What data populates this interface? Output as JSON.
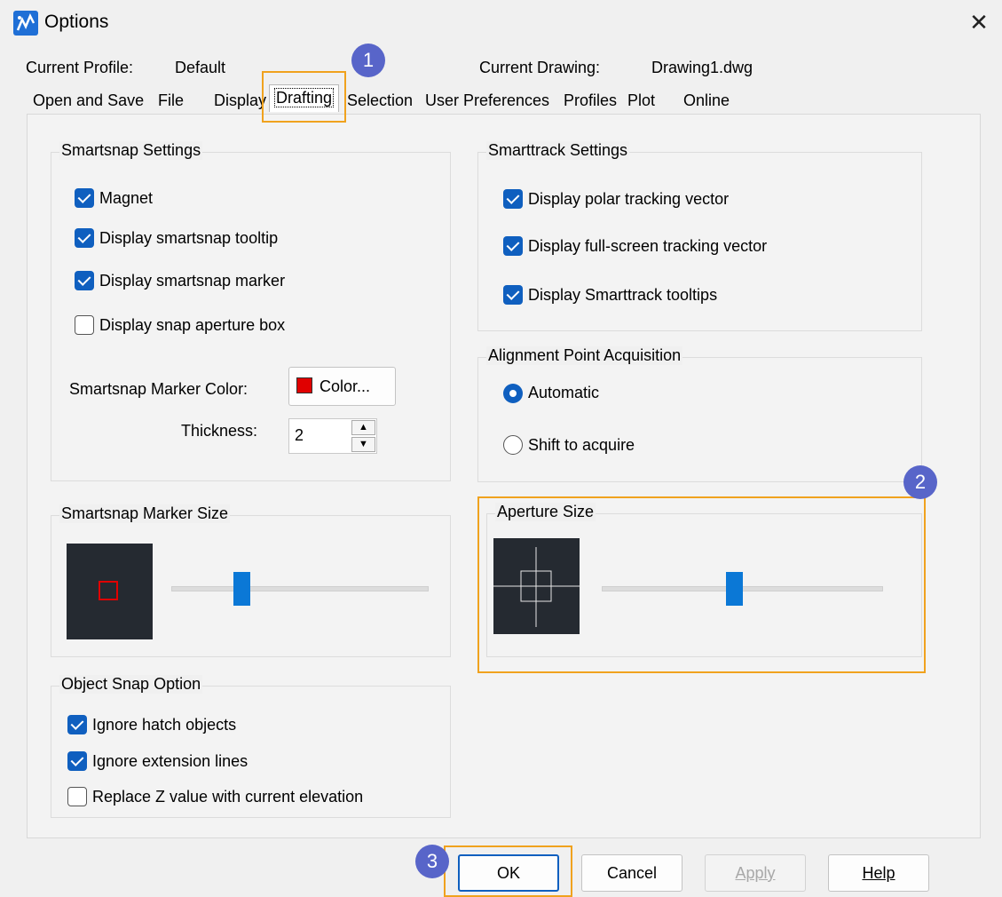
{
  "window": {
    "title": "Options",
    "close_glyph": "✕"
  },
  "profile": {
    "label": "Current Profile:",
    "value": "Default"
  },
  "drawing": {
    "label": "Current Drawing:",
    "value": "Drawing1.dwg"
  },
  "tabs": [
    "Open and Save",
    "File",
    "Display",
    "Drafting",
    "Selection",
    "User Preferences",
    "Profiles",
    "Plot",
    "Online"
  ],
  "active_tab": "Drafting",
  "smartsnap": {
    "title": "Smartsnap Settings",
    "magnet": {
      "label": "Magnet",
      "checked": true
    },
    "tooltip": {
      "label": "Display smartsnap tooltip",
      "checked": true
    },
    "marker": {
      "label": "Display smartsnap marker",
      "checked": true
    },
    "aperture_box": {
      "label": "Display snap aperture box",
      "checked": false
    },
    "color_label": "Smartsnap Marker Color:",
    "color_button": "Color...",
    "marker_color": "#e00000",
    "thickness_label": "Thickness:",
    "thickness_value": "2"
  },
  "smarttrack": {
    "title": "Smarttrack Settings",
    "polar": {
      "label": "Display polar tracking vector",
      "checked": true
    },
    "fullscreen": {
      "label": "Display full-screen tracking vector",
      "checked": true
    },
    "tooltips": {
      "label": "Display Smarttrack tooltips",
      "checked": true
    }
  },
  "alignment": {
    "title": "Alignment Point Acquisition",
    "automatic": {
      "label": "Automatic",
      "selected": true
    },
    "shift": {
      "label": "Shift to acquire",
      "selected": false
    }
  },
  "marker_size": {
    "title": "Smartsnap Marker Size",
    "level": 0.26
  },
  "aperture_size": {
    "title": "Aperture Size",
    "level": 0.47
  },
  "object_snap": {
    "title": "Object Snap Option",
    "hatch": {
      "label": "Ignore hatch objects",
      "checked": true
    },
    "extension": {
      "label": "Ignore extension lines",
      "checked": true
    },
    "replace_z": {
      "label": "Replace Z value with current elevation",
      "checked": false
    }
  },
  "buttons": {
    "ok": "OK",
    "cancel": "Cancel",
    "apply": "Apply",
    "help": "Help"
  },
  "badges": [
    "1",
    "2",
    "3"
  ],
  "colors": {
    "accent": "#0f5fbf",
    "highlight": "#f0a21e",
    "badge": "#5865c9"
  }
}
